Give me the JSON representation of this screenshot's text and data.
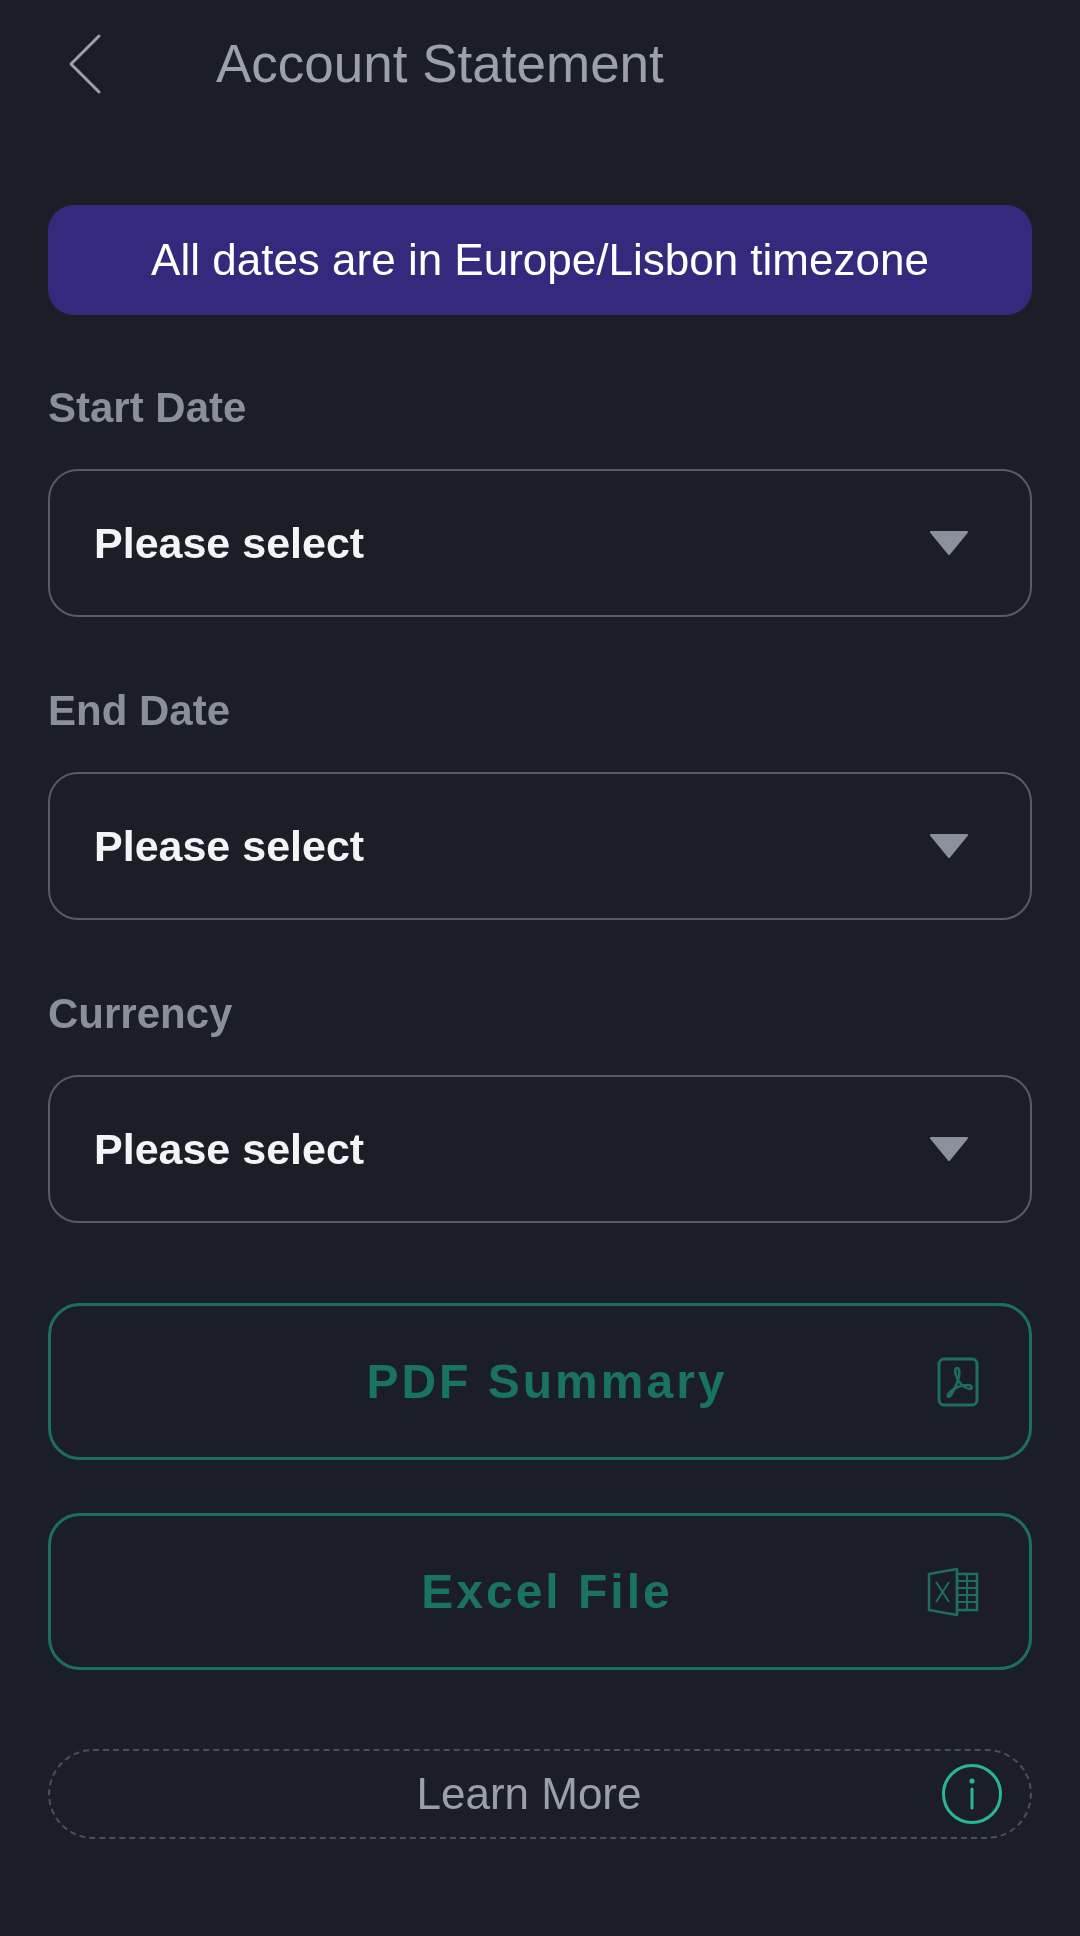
{
  "header": {
    "title": "Account Statement"
  },
  "notice": {
    "text": "All dates are in Europe/Lisbon timezone"
  },
  "fields": [
    {
      "label": "Start Date",
      "placeholder": "Please select"
    },
    {
      "label": "End Date",
      "placeholder": "Please select"
    },
    {
      "label": "Currency",
      "placeholder": "Please select"
    }
  ],
  "export_buttons": [
    {
      "label": "PDF Summary",
      "kind": "pdf"
    },
    {
      "label": "Excel File",
      "kind": "excel"
    }
  ],
  "learn_more": {
    "label": "Learn More"
  }
}
